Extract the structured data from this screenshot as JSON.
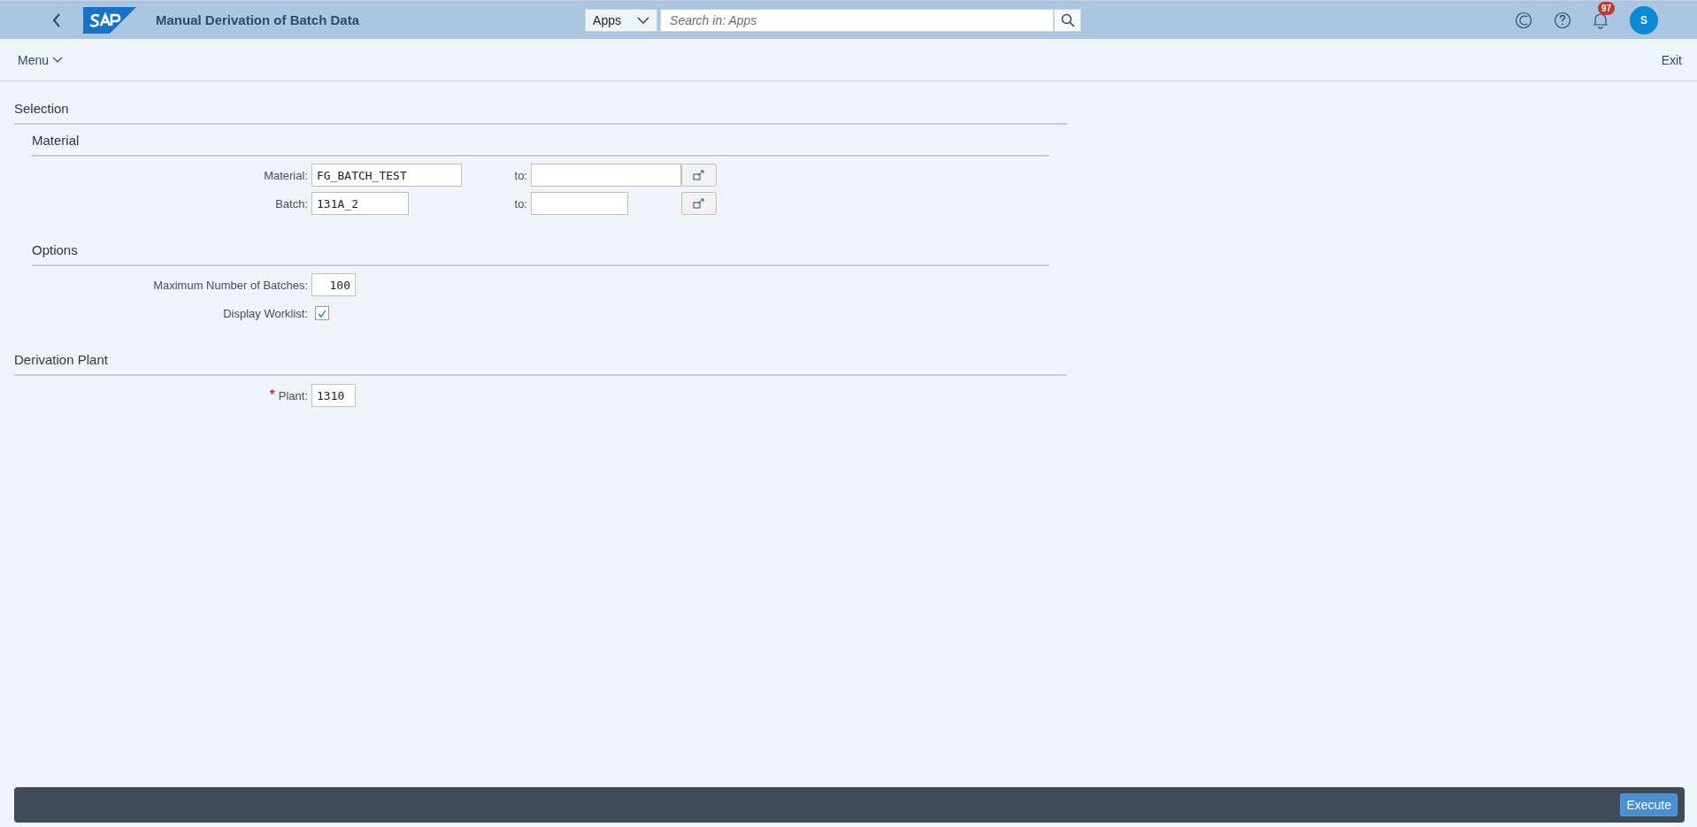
{
  "shell": {
    "title": "Manual Derivation of Batch Data",
    "search_scope": "Apps",
    "search_placeholder": "Search in: Apps",
    "notification_count": "97",
    "avatar_initial": "S"
  },
  "toolbar": {
    "menu": "Menu",
    "exit": "Exit"
  },
  "sections": [
    {
      "title": "Selection",
      "groups": [
        {
          "title": "Material",
          "rows": [
            {
              "kind": "range",
              "label": "Material:",
              "value": "FG_BATCH_TEST",
              "to_label": "to:",
              "to_value": ""
            },
            {
              "kind": "range",
              "label": "Batch:",
              "value": "131A_2",
              "to_label": "to:",
              "to_value": ""
            }
          ]
        },
        {
          "title": "Options",
          "rows": [
            {
              "kind": "number",
              "label": "Maximum Number of Batches:",
              "value": "100"
            },
            {
              "kind": "checkbox",
              "label": "Display Worklist:",
              "checked": true
            }
          ]
        }
      ]
    },
    {
      "title": "Derivation Plant",
      "groups": [
        {
          "rows": [
            {
              "kind": "text",
              "label": "Plant:",
              "required_mark": "*",
              "value": "1310"
            }
          ]
        }
      ]
    }
  ],
  "footer": {
    "execute": "Execute"
  }
}
